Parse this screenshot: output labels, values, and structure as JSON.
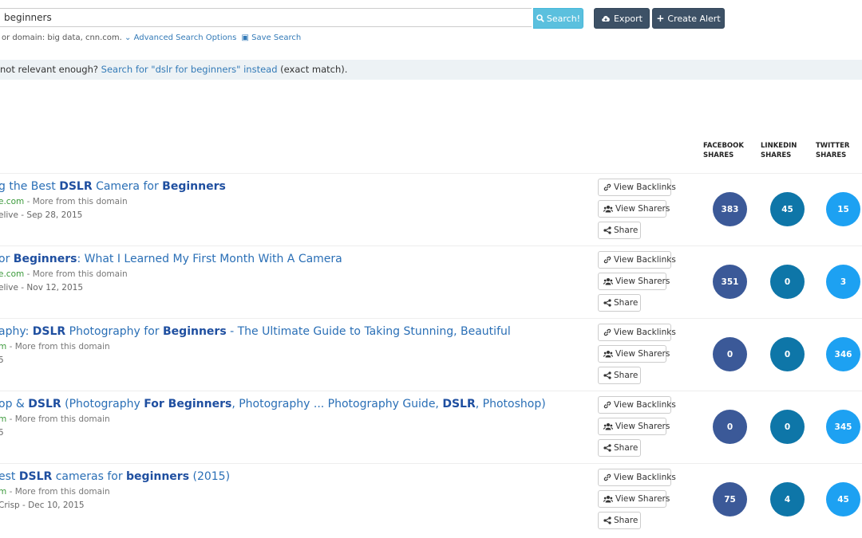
{
  "search": {
    "value": "beginners",
    "button_label": "Search!",
    "export_label": "Export",
    "alert_label": "Create Alert",
    "hint_text": "or domain: big data, cnn.com.",
    "advanced_label": "Advanced Search Options",
    "save_label": "Save Search"
  },
  "notice": {
    "prefix": "not relevant enough?",
    "link": "Search for \"dslr for beginners\" instead",
    "suffix": "(exact match)."
  },
  "columns": {
    "facebook": [
      "FACEBOOK",
      "SHARES"
    ],
    "linkedin": [
      "LINKEDIN",
      "SHARES"
    ],
    "twitter": [
      "TWITTER",
      "SHARES"
    ]
  },
  "actions": {
    "backlinks": "View Backlinks",
    "sharers": "View Sharers",
    "share": "Share"
  },
  "colors": {
    "facebook": "#3b5998",
    "linkedin": "#0e76a8",
    "twitter": "#1da1f2"
  },
  "results": [
    {
      "title_parts": [
        [
          "g the Best ",
          false
        ],
        [
          "DSLR",
          true
        ],
        [
          " Camera for ",
          false
        ],
        [
          "Beginners",
          true
        ]
      ],
      "domain": "e.com",
      "more": "- More from this domain",
      "meta": "elive - Sep 28, 2015",
      "facebook": 383,
      "linkedin": 45,
      "twitter": 15
    },
    {
      "title_parts": [
        [
          "or ",
          false
        ],
        [
          "Beginners",
          true
        ],
        [
          ": What I Learned My First Month With A Camera",
          false
        ]
      ],
      "domain": "e.com",
      "more": "- More from this domain",
      "meta": "elive - Nov 12, 2015",
      "facebook": 351,
      "linkedin": 0,
      "twitter": 3
    },
    {
      "title_parts": [
        [
          "aphy: ",
          false
        ],
        [
          "DSLR",
          true
        ],
        [
          " Photography for ",
          false
        ],
        [
          "Beginners",
          true
        ],
        [
          " - The Ultimate Guide to Taking Stunning, Beautiful",
          false
        ]
      ],
      "domain": "m",
      "more": "- More from this domain",
      "meta": "5",
      "facebook": 0,
      "linkedin": 0,
      "twitter": 346
    },
    {
      "title_parts": [
        [
          "op & ",
          false
        ],
        [
          "DSLR",
          true
        ],
        [
          " (Photography ",
          false
        ],
        [
          "For Beginners",
          true
        ],
        [
          ", Photography ... Photography Guide, ",
          false
        ],
        [
          "DSLR",
          true
        ],
        [
          ", Photoshop)",
          false
        ]
      ],
      "domain": "m",
      "more": "- More from this domain",
      "meta": "5",
      "facebook": 0,
      "linkedin": 0,
      "twitter": 345
    },
    {
      "title_parts": [
        [
          "est ",
          false
        ],
        [
          "DSLR",
          true
        ],
        [
          " cameras for ",
          false
        ],
        [
          "beginners",
          true
        ],
        [
          " (2015)",
          false
        ]
      ],
      "domain": "m",
      "more": "- More from this domain",
      "meta": "Crisp - Dec 10, 2015",
      "facebook": 75,
      "linkedin": 4,
      "twitter": 45
    }
  ]
}
